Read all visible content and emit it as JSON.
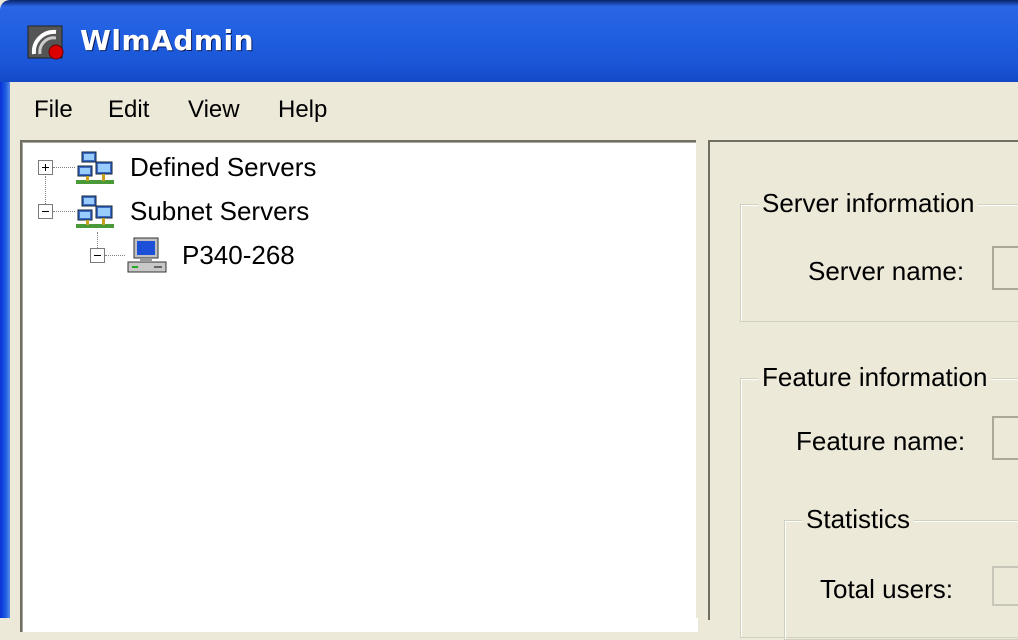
{
  "window": {
    "title": "WlmAdmin",
    "icon": "wlmadmin-app-icon"
  },
  "menu": {
    "items": [
      {
        "label": "File"
      },
      {
        "label": "Edit"
      },
      {
        "label": "View"
      },
      {
        "label": "Help"
      }
    ]
  },
  "tree": {
    "nodes": [
      {
        "label": "Defined Servers",
        "expander": "+",
        "icon": "network-servers-icon"
      },
      {
        "label": "Subnet Servers",
        "expander": "-",
        "icon": "network-servers-icon"
      },
      {
        "label": "P340-268",
        "expander": "-",
        "icon": "computer-icon"
      }
    ]
  },
  "details": {
    "server_group": {
      "legend": "Server information",
      "server_name_label": "Server name:"
    },
    "feature_group": {
      "legend": "Feature information",
      "feature_name_label": "Feature name:",
      "statistics": {
        "legend": "Statistics",
        "total_users_label": "Total users:"
      }
    }
  },
  "colors": {
    "titlebar": "#1f5fe0",
    "window_bg": "#ece9d8",
    "tree_bg": "#ffffff"
  }
}
